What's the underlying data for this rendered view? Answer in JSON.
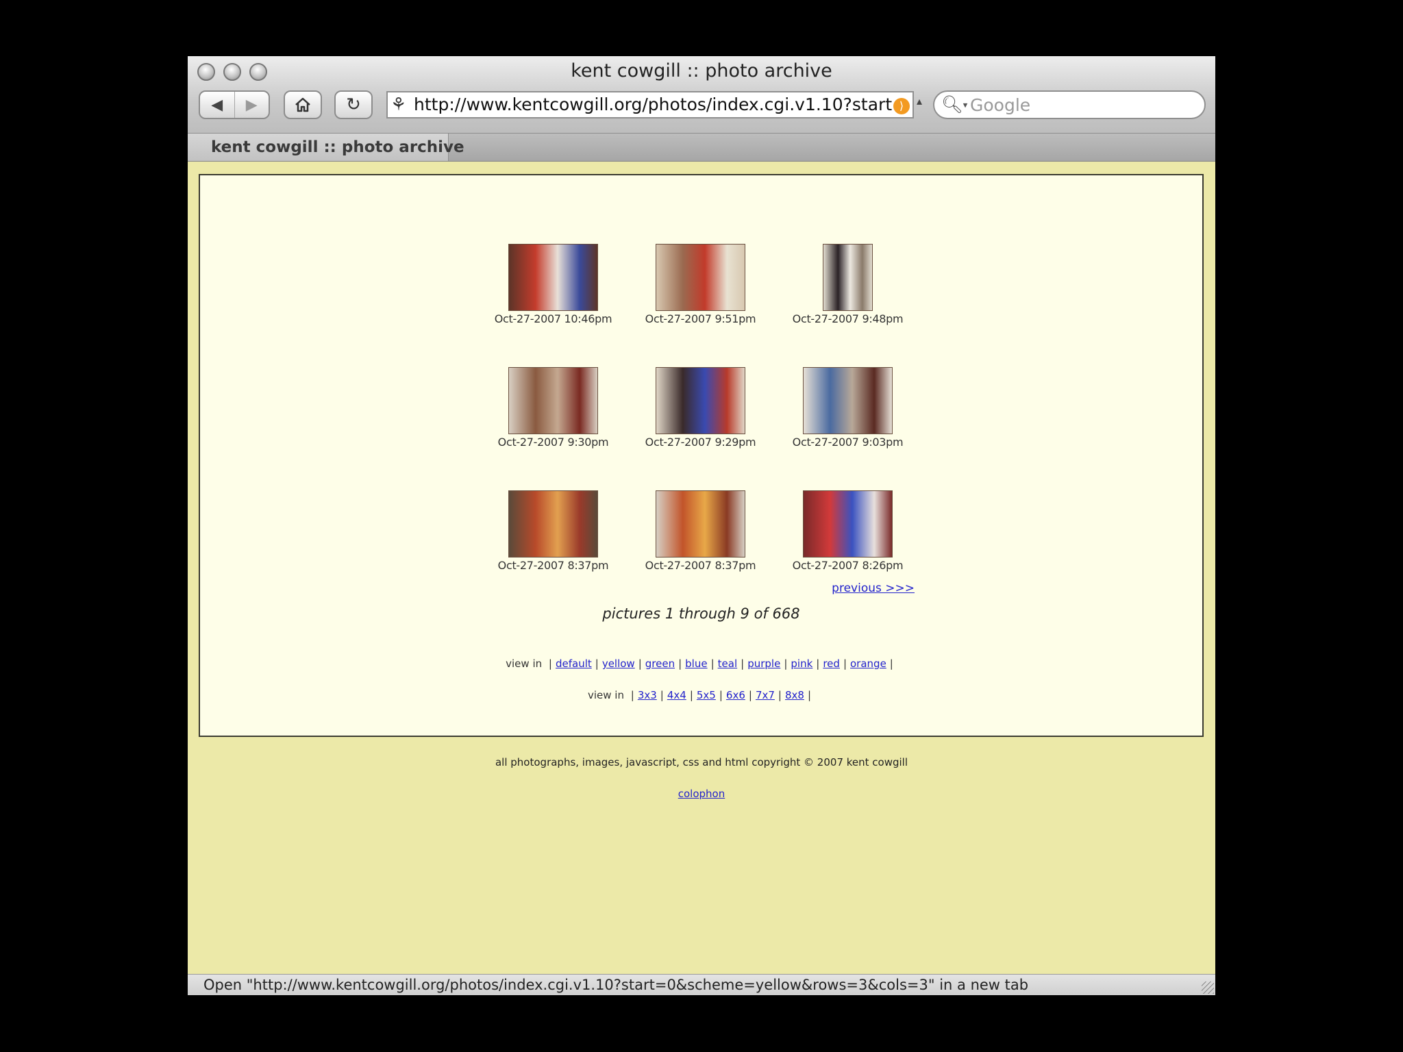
{
  "window": {
    "title": "kent cowgill :: photo archive"
  },
  "toolbar": {
    "back_icon": "back-arrow-icon",
    "forward_icon": "forward-arrow-icon",
    "home_icon": "home-icon",
    "reload_icon": "reload-icon",
    "url": "http://www.kentcowgill.org/photos/index.cgi.v1.10?start",
    "search_placeholder": "Google"
  },
  "tab": {
    "label": "kent cowgill :: photo archive"
  },
  "photos": [
    {
      "caption": "Oct-27-2007 10:46pm",
      "colors": [
        "#5c3428",
        "#c43c2c",
        "#e8e0d8",
        "#3a4a9a"
      ]
    },
    {
      "caption": "Oct-27-2007 9:51pm",
      "colors": [
        "#d8c8b0",
        "#9a6a50",
        "#c23a2a",
        "#e8e2d2"
      ]
    },
    {
      "caption": "Oct-27-2007 9:48pm",
      "colors": [
        "#e2dcd0",
        "#2a2226",
        "#ece8e0",
        "#8a7a6a"
      ]
    },
    {
      "caption": "Oct-27-2007 9:30pm",
      "colors": [
        "#d8cfc2",
        "#8a5a40",
        "#c4a890",
        "#7a2a22"
      ]
    },
    {
      "caption": "Oct-27-2007 9:29pm",
      "colors": [
        "#e0d6c6",
        "#3a2a2a",
        "#3a4ab0",
        "#b83a2a"
      ]
    },
    {
      "caption": "Oct-27-2007 9:03pm",
      "colors": [
        "#e6e0d6",
        "#4a6aa0",
        "#b8a898",
        "#5a2a22"
      ]
    },
    {
      "caption": "Oct-27-2007 8:37pm",
      "colors": [
        "#5a4a3a",
        "#b84a2a",
        "#e2a050",
        "#9a3a2a"
      ]
    },
    {
      "caption": "Oct-27-2007 8:37pm",
      "colors": [
        "#d6cfc4",
        "#c2542a",
        "#e8a848",
        "#8a3a24"
      ]
    },
    {
      "caption": "Oct-27-2007 8:26pm",
      "colors": [
        "#7a2a2a",
        "#d23a3a",
        "#3a52c0",
        "#e8e0dc"
      ]
    }
  ],
  "pagination": {
    "previous": "previous >>>",
    "summary": "pictures 1 through 9 of 668"
  },
  "color_schemes": {
    "label": "view in",
    "options": [
      "default",
      "yellow",
      "green",
      "blue",
      "teal",
      "purple",
      "pink",
      "red",
      "orange"
    ]
  },
  "grid_sizes": {
    "label": "view in",
    "options": [
      "3x3",
      "4x4",
      "5x5",
      "6x6",
      "7x7",
      "8x8"
    ]
  },
  "footer": {
    "copyright": "all photographs, images, javascript, css and html copyright © 2007 kent cowgill",
    "colophon": "colophon"
  },
  "status": {
    "text": "Open \"http://www.kentcowgill.org/photos/index.cgi.v1.10?start=0&scheme=yellow&rows=3&cols=3\" in a new tab"
  }
}
